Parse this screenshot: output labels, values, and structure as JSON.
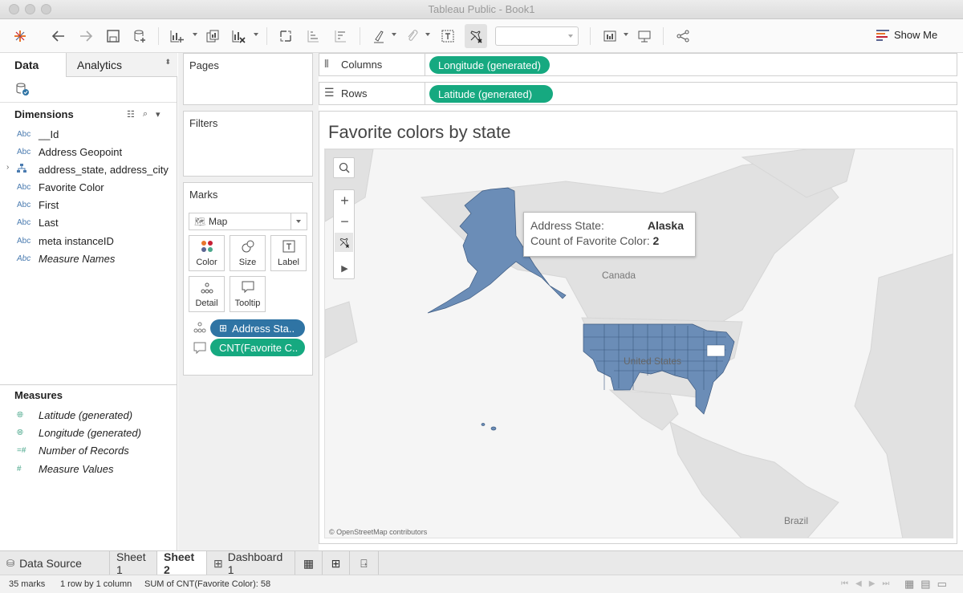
{
  "window": {
    "title": "Tableau Public - Book1"
  },
  "toolbar": {
    "show_me_label": "Show Me"
  },
  "side_panel": {
    "tabs": [
      "Data",
      "Analytics"
    ],
    "dimensions_title": "Dimensions",
    "dimensions": [
      {
        "type": "Abc",
        "name": "__Id"
      },
      {
        "type": "Abc",
        "name": "Address Geopoint"
      },
      {
        "type": "hierarchy",
        "name": "address_state, address_city"
      },
      {
        "type": "Abc",
        "name": "Favorite Color"
      },
      {
        "type": "Abc",
        "name": "First"
      },
      {
        "type": "Abc",
        "name": "Last"
      },
      {
        "type": "Abc",
        "name": "meta instanceID"
      },
      {
        "type": "Abc",
        "name": "Measure Names"
      }
    ],
    "measures_title": "Measures",
    "measures": [
      {
        "type": "globe",
        "name": "Latitude (generated)"
      },
      {
        "type": "globe",
        "name": "Longitude (generated)"
      },
      {
        "type": "=#",
        "name": "Number of Records"
      },
      {
        "type": "#",
        "name": "Measure Values"
      }
    ]
  },
  "cards": {
    "pages": "Pages",
    "filters": "Filters",
    "marks": "Marks",
    "mark_type": "Map",
    "mark_buttons": [
      "Color",
      "Size",
      "Label",
      "Detail",
      "Tooltip"
    ],
    "mark_pills": [
      "Address Sta..",
      "CNT(Favorite C.."
    ]
  },
  "shelves": {
    "columns_label": "Columns",
    "columns_pill": "Longitude (generated)",
    "rows_label": "Rows",
    "rows_pill": "Latitude (generated)"
  },
  "view": {
    "title": "Favorite colors by state",
    "map_labels": {
      "canada": "Canada",
      "us": "United States",
      "brazil": "Brazil"
    },
    "attribution": "© OpenStreetMap contributors",
    "tooltip": {
      "row1_label": "Address State:",
      "row1_value": "Alaska",
      "row2_label": "Count of Favorite Color:",
      "row2_value": "2"
    }
  },
  "sheet_tabs": [
    "Data Source",
    "Sheet 1",
    "Sheet 2",
    "Dashboard 1"
  ],
  "active_tab": "Sheet 2",
  "status": {
    "marks": "35 marks",
    "dims": "1 row by 1 column",
    "sum": "SUM of CNT(Favorite Color): 58"
  },
  "colors": {
    "pill_green": "#16a980",
    "pill_blue": "#2f74a4",
    "state_fill": "#6b8db7"
  }
}
